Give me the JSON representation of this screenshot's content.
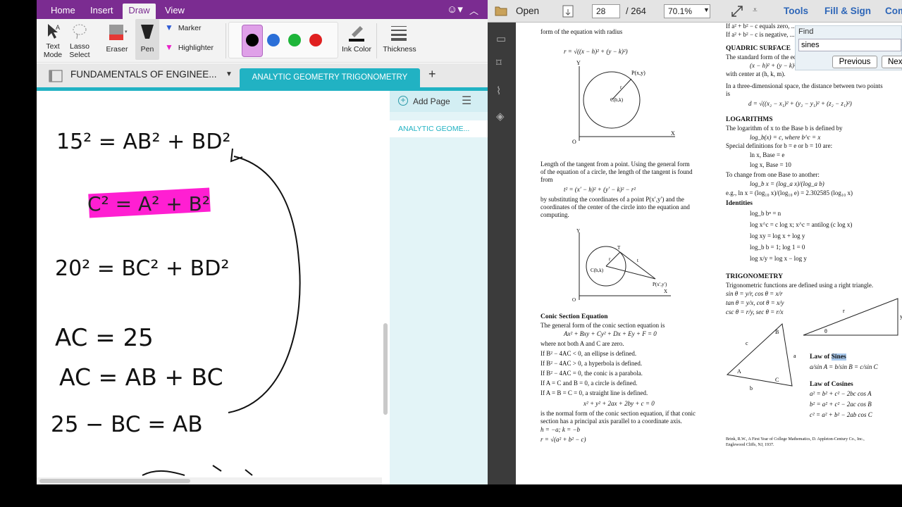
{
  "onenote": {
    "tabs": [
      "Home",
      "Insert",
      "Draw",
      "View"
    ],
    "tools": {
      "text_mode": "Text Mode",
      "lasso_select": "Lasso Select",
      "eraser": "Eraser",
      "pen": "Pen",
      "marker": "Marker",
      "highlighter": "Highlighter",
      "ink_color": "Ink Color",
      "thickness": "Thickness"
    },
    "notebook_name": "FUNDAMENTALS OF ENGINEE...",
    "section_tab": "ANALYTIC GEOMETRY  TRIGONOMETRY",
    "add_page": "Add Page",
    "page_title": "ANALYTIC GEOME...",
    "handwriting": {
      "line1": "15² = AB² + BD²",
      "line2": "C² = A² + B²",
      "line3": "20² = BC² + BD²",
      "line4": "AC = 25",
      "line5": "AC = AB + BC",
      "line6": "25 − BC = AB"
    },
    "colors": {
      "accent": "#7b2c91",
      "section": "#21b2c3",
      "highlight": "#ff1fd2"
    }
  },
  "pdf": {
    "open": "Open",
    "page_current": "28",
    "page_total": "/ 264",
    "zoom": "70.1%",
    "tools": "Tools",
    "fill_sign": "Fill & Sign",
    "comment": "Com",
    "find_label": "Find",
    "find_value": "sines",
    "previous": "Previous",
    "next": "Nex",
    "left_col": {
      "top_text": "form of the equation with radius",
      "circle_eq": "r = √((x − h)² + (y − k)²)",
      "tangent_p1": "Length of the tangent from a point. Using the general form",
      "tangent_p2": "of the equation of a circle, the length of the tangent is found",
      "tangent_p3": "from",
      "tangent_eq": "t² = (x′ − h)² + (y′ − k)² − r²",
      "tangent_p4": "by substituting the coordinates of a point P(x′,y′) and the",
      "tangent_p5": "coordinates of the center of the circle into the equation and",
      "tangent_p6": "computing.",
      "conic_head": "Conic Section Equation",
      "conic_p1": "The general form of the conic section equation is",
      "conic_eq": "Ax² + Bxy + Cy² + Dx + Ey + F = 0",
      "conic_p2": "where not both A and C are zero.",
      "conic_r1": "If B² − 4AC < 0, an ellipse is defined.",
      "conic_r2": "If B² − 4AC > 0, a hyperbola is defined.",
      "conic_r3": "If B² − 4AC = 0, the conic is a parabola.",
      "conic_r4": "If A = C and B = 0, a circle is defined.",
      "conic_r5": "If A = B = C = 0, a straight line is defined.",
      "normal_eq": "x² + y² + 2ax + 2by + c = 0",
      "normal_p1": "is the normal form of the conic section equation, if that conic",
      "normal_p2": "section has a principal axis parallel to a coordinate axis.",
      "hk": "h = −a; k = −b",
      "r_eq": "r = √(a² + b² − c)",
      "fig1_labels": [
        "Y",
        "P(x,y)",
        "r",
        "C(h,k)",
        "X",
        "O"
      ],
      "fig2_labels": [
        "Y",
        "T",
        "r",
        "t",
        "C(h,k)",
        "P(x′,y′)",
        "X",
        "O"
      ]
    },
    "right_col": {
      "top1": "If a² + b² − c equals zero, ...",
      "top2": "If a² + b² − c is negative, ...",
      "quadric_head": "QUADRIC SURFACE",
      "quadric_p1": "The standard form of the equation is",
      "quadric_eq": "(x − h)² + (y − k)² + (z − m)² = r²",
      "quadric_p2": "with center at (h, k, m).",
      "dist_p1": "In a three-dimensional space, the distance between two points",
      "dist_p2": "is",
      "dist_eq": "d = √((x₂ − x₁)² + (y₂ − y₁)² + (z₂ − z₁)²)",
      "log_head": "LOGARITHMS",
      "log_p1": "The logarithm of x to the Base b is defined by",
      "log_eq1": "log_b(x) = c, where b^c = x",
      "log_p2": "Special definitions for b = e or b = 10 are:",
      "log_eq2": "ln x, Base = e",
      "log_eq3": "log x, Base = 10",
      "log_p3": "To change from one Base to another:",
      "log_eq4": "log_b x = (log_a x)/(log_a b)",
      "log_eq5": "e.g., ln x = (log₁₀ x)/(log₁₀ e) = 2.302585 (log₁₀ x)",
      "id_head": "Identities",
      "id1": "log_b bⁿ = n",
      "id2": "log x^c = c log x; x^c = antilog (c log x)",
      "id3": "log xy = log x + log y",
      "id4": "log_b b = 1; log 1 = 0",
      "id5": "log x/y = log x − log y",
      "trig_head": "TRIGONOMETRY",
      "trig_p1": "Trigonometric functions are defined using a right triangle.",
      "trig1": "sin θ = y/r, cos θ = x/r",
      "trig2": "tan θ = y/x, cot θ = x/y",
      "trig3": "csc θ = r/y, sec θ = r/x",
      "sines_head": "Law of Sines",
      "sines_eq": "a/sin A = b/sin B = c/sin C",
      "cos_head": "Law of Cosines",
      "cos1": "a² = b² + c² − 2bc cos A",
      "cos2": "b² = a² + c² − 2ac cos B",
      "cos3": "c² = a² + b² − 2ab cos C",
      "footnote1": "Brink, R.W., A First Year of College Mathematics, D. Appleton-Century Co., Inc.,",
      "footnote2": "Englewood Cliffs, NJ, 1937.",
      "tri_labels": [
        "r",
        "y",
        "θ",
        "x"
      ],
      "abc_labels": [
        "B",
        "c",
        "a",
        "A",
        "C",
        "b"
      ]
    }
  }
}
